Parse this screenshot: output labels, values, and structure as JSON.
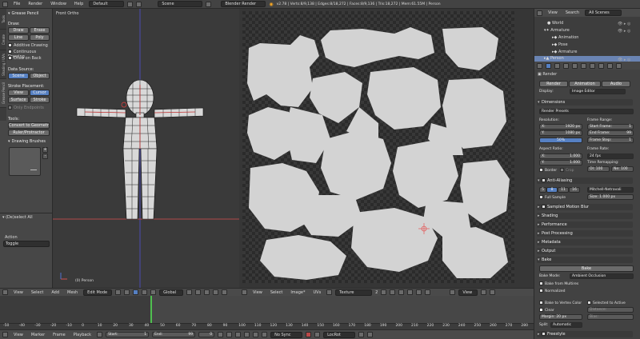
{
  "topbar": {
    "menus": [
      "File",
      "Render",
      "Window",
      "Help"
    ],
    "layout": "Default",
    "scene": "Scene",
    "engine": "Blender Render",
    "stats": "v2.78 | Verts:8/9,138 | Edges:8/18,272 | Faces:8/9,136 | Tris:18,272 | Mem:61.55M | Person"
  },
  "left_panel": {
    "tabs": [
      "Tools",
      "Create",
      "Shading / UVs",
      "Grease Pencil"
    ],
    "title": "Grease Pencil",
    "draw_label": "Draw:",
    "draw_btn": "Draw",
    "erase_btn": "Erase",
    "line_btn": "Line",
    "poly_btn": "Poly",
    "additive": "Additive Drawing",
    "continuous": "Continuous Drawing",
    "draw_on_back": "Draw on Back",
    "data_source": "Data Source:",
    "scene_btn": "Scene",
    "object_btn": "Object",
    "stroke_placement": "Stroke Placement:",
    "view_btn": "View",
    "cursor_btn": "Cursor",
    "surface_btn": "Surface",
    "stroke_btn": "Stroke",
    "only_endpoints": "Only Endpoints",
    "tools_label": "Tools:",
    "convert_btn": "Convert to Geometr",
    "ruler_btn": "Ruler/Protractor",
    "drawing_brushes": "Drawing Brushes",
    "deselect_all": "(De)select All",
    "action_label": "Action",
    "action_value": "Toggle"
  },
  "viewport": {
    "title": "Front Ortho",
    "object_label": "(0) Person",
    "header_items": [
      "View",
      "Select",
      "Add",
      "Mesh"
    ],
    "mode": "Edit Mode",
    "orientation": "Global"
  },
  "uv_editor": {
    "header_items": [
      "View",
      "Select",
      "Image*",
      "UVs"
    ],
    "image_name": "Texture",
    "image_users": "2",
    "view_menu": "View"
  },
  "timeline": {
    "header_items": [
      "View",
      "Marker",
      "Frame",
      "Playback"
    ],
    "start_label": "Start:",
    "start_value": "1",
    "end_label": "End:",
    "end_value": "99",
    "current_frame": "0",
    "sync": "No Sync",
    "keying": "LocRot",
    "ruler": [
      "-50",
      "-40",
      "-30",
      "-20",
      "-10",
      "0",
      "10",
      "20",
      "30",
      "40",
      "50",
      "60",
      "70",
      "80",
      "90",
      "100",
      "110",
      "120",
      "130",
      "140",
      "150",
      "160",
      "170",
      "180",
      "190",
      "200",
      "210",
      "220",
      "230",
      "240",
      "250",
      "260",
      "270",
      "280"
    ],
    "playhead_frame": 0
  },
  "outliner": {
    "header": [
      "View",
      "Search"
    ],
    "scenes": "All Scenes",
    "items": [
      "World",
      "Armature",
      "Animation",
      "Pose",
      "Armature",
      "Person"
    ]
  },
  "properties": {
    "render_title": "Render",
    "render_btn": "Render",
    "animation_btn": "Animation",
    "audio_btn": "Audio",
    "display_label": "Display:",
    "display_value": "Image Editor",
    "dimensions": "Dimensions",
    "render_presets": "Render Presets",
    "resolution": "Resolution:",
    "res_x": "1920 px",
    "res_y": "1080 px",
    "res_pct": "50%",
    "frame_range": "Frame Range:",
    "start_frame": "Start Frame:",
    "start_frame_val": "1",
    "end_frame": "End Frame:",
    "end_frame_val": "99",
    "frame_step": "Frame Step:",
    "frame_step_val": "1",
    "aspect_ratio": "Aspect Ratio:",
    "aspect_x": "1.000",
    "aspect_y": "1.000",
    "frame_rate": "Frame Rate:",
    "fps": "24 fps",
    "time_remap": "Time Remapping:",
    "old": "Ol: 100",
    "new": "Ne: 100",
    "border": "Border",
    "crop": "Crop",
    "anti_aliasing": "Anti-Aliasing",
    "aa_samples": [
      "5",
      "8",
      "11",
      "16"
    ],
    "aa_filter": "Mitchell-Netravali",
    "full_sample": "Full Sample",
    "aa_size": "Size: 1.000 px",
    "sampled_motion_blur": "Sampled Motion Blur",
    "sections": [
      "Shading",
      "Performance",
      "Post Processing",
      "Metadata",
      "Output"
    ],
    "bake": "Bake",
    "bake_btn": "Bake",
    "bake_mode_label": "Bake Mode:",
    "bake_mode": "Ambient Occlusion",
    "bake_from_multires": "Bake from Multires",
    "normalized": "Normalized",
    "bake_to_vertex": "Bake to Vertex Color",
    "selected_to_active": "Selected to Active",
    "clear": "Clear",
    "margin": "Margin: 20 px",
    "distance": "Distance:",
    "bias": "Bias:",
    "split_label": "Split:",
    "split_value": "Automatic",
    "freestyle": "Freestyle"
  }
}
